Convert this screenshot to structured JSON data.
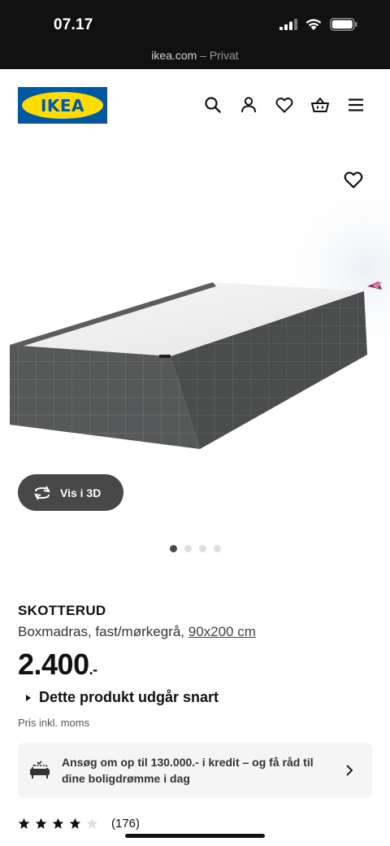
{
  "status_bar": {
    "time": "07.17"
  },
  "browser": {
    "domain": "ikea.com",
    "separator": " – ",
    "mode": "Privat"
  },
  "header": {
    "logo_text": "IKEA",
    "icons": [
      "search-icon",
      "account-icon",
      "favourites-icon",
      "basket-icon",
      "menu-icon"
    ]
  },
  "gallery": {
    "view_3d_label": "Vis i 3D",
    "dots_total": 4,
    "active_dot": 1
  },
  "product": {
    "name": "SKOTTERUD",
    "description": "Boxmadras, fast/mørkegrå, ",
    "size_link": "90x200 cm",
    "price": "2.400",
    "price_suffix": ".-",
    "expiring_notice": "Dette produkt udgår snart",
    "vat_note": "Pris inkl. moms"
  },
  "credit_banner": {
    "text": "Ansøg om op til 130.000.- i kredit – og få råd til dine boligdrømme i dag"
  },
  "rating": {
    "stars": 4,
    "max_stars": 5,
    "count": "(176)"
  },
  "colors": {
    "ikea_blue": "#0058a3",
    "ikea_yellow": "#ffdb00",
    "product_grey": "#56585a"
  }
}
